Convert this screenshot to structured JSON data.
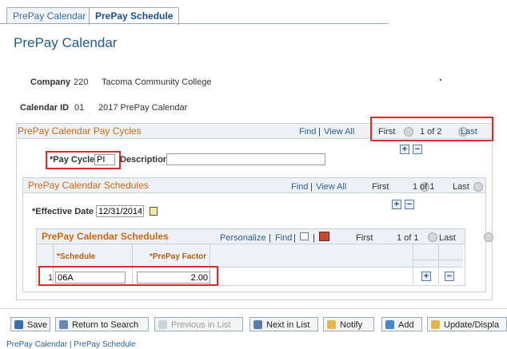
{
  "tabs": [
    {
      "label": "PrePay Calendar",
      "active": false
    },
    {
      "label": "PrePay Schedule",
      "active": true
    }
  ],
  "page_title": "PrePay Calendar",
  "company": {
    "label": "Company",
    "code": "220",
    "name": "Tacoma Community College"
  },
  "calendar": {
    "label": "Calendar ID",
    "code": "01",
    "name": "2017 PrePay Calendar"
  },
  "pay_cycles": {
    "title": "PrePay Calendar Pay Cycles",
    "find": "Find",
    "view_all": "View All",
    "first": "First",
    "counter": "1 of 2",
    "last": "Last",
    "pay_cycle_label": "*Pay Cycle",
    "pay_cycle_value": "PI",
    "description_label": "Description",
    "description_value": ""
  },
  "schedules": {
    "title": "PrePay Calendar Schedules",
    "find": "Find",
    "view_all": "View All",
    "first": "First",
    "counter": "1 of 1",
    "last": "Last",
    "effective_date_label": "*Effective Date",
    "effective_date_value": "12/31/2014"
  },
  "grid": {
    "title": "PrePay Calendar Schedules",
    "personalize": "Personalize",
    "find": "Find",
    "first": "First",
    "counter": "1 of 1",
    "last": "Last",
    "columns": [
      "*Schedule",
      "*PrePay Factor"
    ],
    "rows": [
      {
        "num": "1",
        "schedule": "06A",
        "factor": "2.00"
      }
    ]
  },
  "toolbar": {
    "save": "Save",
    "return_to_search": "Return to Search",
    "previous_in_list": "Previous in List",
    "next_in_list": "Next in List",
    "notify": "Notify",
    "add": "Add",
    "update_display": "Update/Displa"
  },
  "footer_links": "PrePay Calendar | PrePay Schedule",
  "colors": {
    "accent": "#1f5b8e",
    "group_title": "#c96a18",
    "highlight": "#d92b2b"
  }
}
